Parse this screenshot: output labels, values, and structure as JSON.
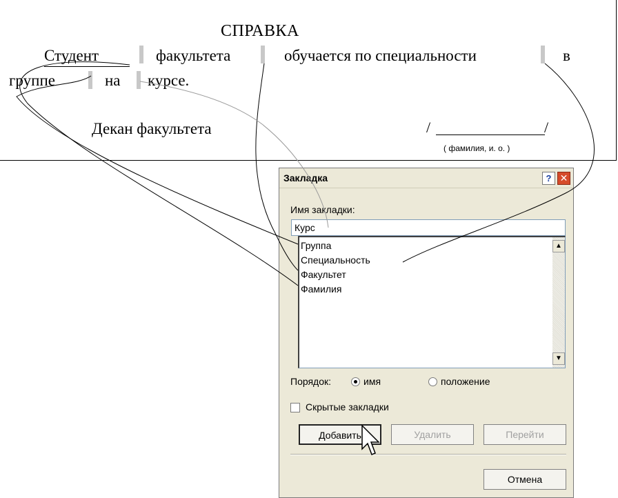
{
  "document": {
    "title": "СПРАВКА",
    "line1": {
      "student": "Студент",
      "faculty": "факультета",
      "studies": "обучается по специальности",
      "in": "в"
    },
    "line2": {
      "group": "группе",
      "on": "на",
      "course": "курсе."
    },
    "dean": "Декан факультета",
    "signature_caption": "( фамилия, и. о. )",
    "slash": "/"
  },
  "dialog": {
    "title": "Закладка",
    "help": "?",
    "close": "✕",
    "name_label": "Имя закладки:",
    "name_value": "Курс",
    "bookmarks": [
      "Группа",
      "Специальность",
      "Факультет",
      "Фамилия"
    ],
    "order_label": "Порядок:",
    "order_options": [
      "имя",
      "положение"
    ],
    "order_selected": "имя",
    "hidden_label": "Скрытые закладки",
    "hidden_checked": false,
    "buttons": {
      "add": "Добавить",
      "delete": "Удалить",
      "goto": "Перейти",
      "cancel": "Отмена"
    },
    "scroll_up": "▲",
    "scroll_down": "▼"
  }
}
